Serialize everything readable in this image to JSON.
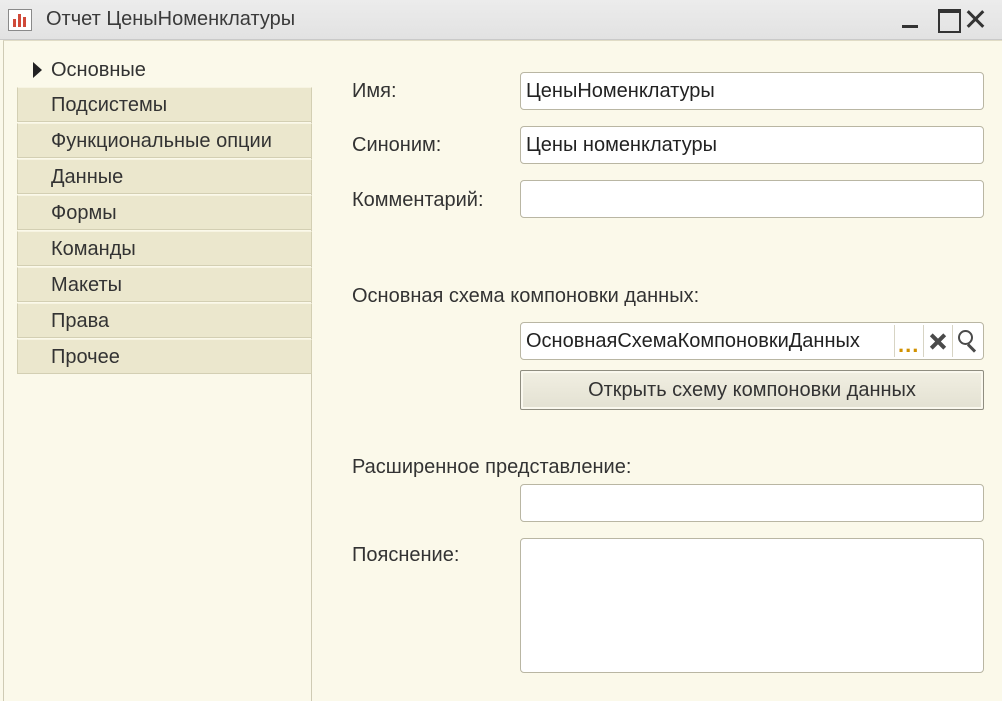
{
  "window": {
    "title": "Отчет ЦеныНоменклатуры",
    "controls": [
      "minimize-icon",
      "maximize-icon",
      "close-icon"
    ]
  },
  "nav": {
    "items": [
      {
        "label": "Основные",
        "active": true
      },
      {
        "label": "Подсистемы"
      },
      {
        "label": "Функциональные опции"
      },
      {
        "label": "Данные"
      },
      {
        "label": "Формы"
      },
      {
        "label": "Команды"
      },
      {
        "label": "Макеты"
      },
      {
        "label": "Права"
      },
      {
        "label": "Прочее"
      }
    ]
  },
  "form": {
    "name_label": "Имя:",
    "name_value": "ЦеныНоменклатуры",
    "synonym_label": "Синоним:",
    "synonym_value": "Цены номенклатуры",
    "comment_label": "Комментарий:",
    "comment_value": "",
    "main_scheme_label": "Основная схема компоновки данных:",
    "main_scheme_value": "ОсновнаяСхемаКомпоновкиДанных",
    "dots_label": "...",
    "open_scheme_button": "Открыть схему компоновки данных",
    "extended_label": "Расширенное представление:",
    "extended_value": "",
    "explanation_label": "Пояснение:",
    "explanation_value": ""
  }
}
